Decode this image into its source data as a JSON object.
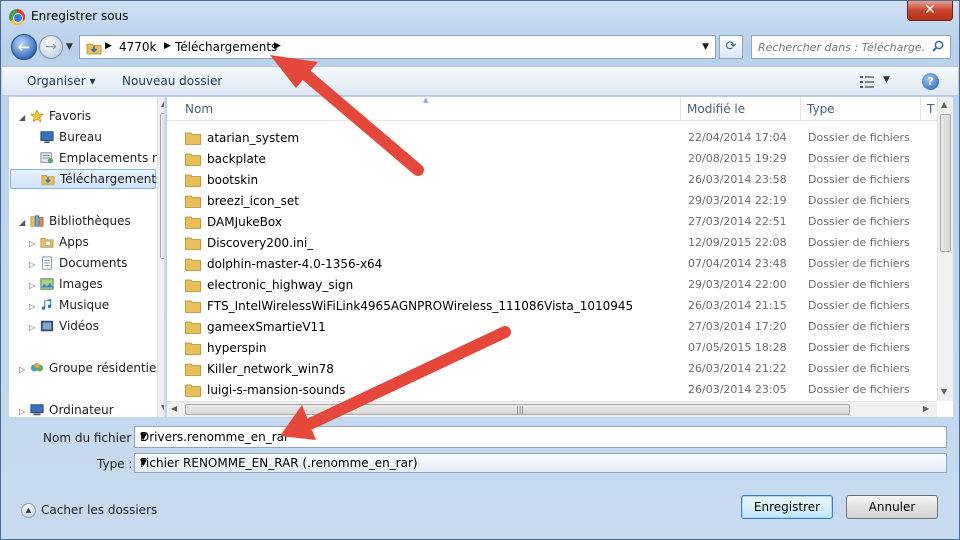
{
  "window": {
    "title": "Enregistrer sous",
    "close_label": "✕"
  },
  "address": {
    "crumbs": [
      "4770k",
      "Téléchargements"
    ],
    "search_placeholder": "Rechercher dans : Télécharge..."
  },
  "toolbar": {
    "organize_label": "Organiser ▾",
    "new_folder_label": "Nouveau dossier"
  },
  "nav": {
    "items": [
      {
        "label": "Favoris",
        "icon": "star-icon"
      },
      {
        "label": "Bureau",
        "icon": "desktop-icon"
      },
      {
        "label": "Emplacements récents",
        "icon": "recent-places-icon"
      },
      {
        "label": "Téléchargements",
        "icon": "downloads-folder-icon"
      },
      {
        "label": "Bibliothèques",
        "icon": "libraries-icon"
      },
      {
        "label": "Apps",
        "icon": "apps-icon"
      },
      {
        "label": "Documents",
        "icon": "documents-icon"
      },
      {
        "label": "Images",
        "icon": "images-icon"
      },
      {
        "label": "Musique",
        "icon": "music-icon"
      },
      {
        "label": "Vidéos",
        "icon": "videos-icon"
      },
      {
        "label": "Groupe résidentiel",
        "icon": "homegroup-icon"
      },
      {
        "label": "Ordinateur",
        "icon": "computer-icon"
      }
    ]
  },
  "columns": {
    "name": "Nom",
    "modified": "Modifié le",
    "type": "Type",
    "size": "T"
  },
  "files": [
    {
      "name": "atarian_system",
      "date": "22/04/2014 17:04",
      "type": "Dossier de fichiers"
    },
    {
      "name": "backplate",
      "date": "20/08/2015 19:29",
      "type": "Dossier de fichiers"
    },
    {
      "name": "bootskin",
      "date": "26/03/2014 23:58",
      "type": "Dossier de fichiers"
    },
    {
      "name": "breezi_icon_set",
      "date": "29/03/2014 22:19",
      "type": "Dossier de fichiers"
    },
    {
      "name": "DAMJukeBox",
      "date": "27/03/2014 22:51",
      "type": "Dossier de fichiers"
    },
    {
      "name": "Discovery200.ini_",
      "date": "12/09/2015 22:08",
      "type": "Dossier de fichiers"
    },
    {
      "name": "dolphin-master-4.0-1356-x64",
      "date": "07/04/2014 23:48",
      "type": "Dossier de fichiers"
    },
    {
      "name": "electronic_highway_sign",
      "date": "29/03/2014 22:00",
      "type": "Dossier de fichiers"
    },
    {
      "name": "FTS_IntelWirelessWiFiLink4965AGNPROWireless_111086Vista_1010945",
      "date": "26/03/2014 21:15",
      "type": "Dossier de fichiers"
    },
    {
      "name": "gameexSmartieV11",
      "date": "27/03/2014 17:20",
      "type": "Dossier de fichiers"
    },
    {
      "name": "hyperspin",
      "date": "07/05/2015 18:28",
      "type": "Dossier de fichiers"
    },
    {
      "name": "Killer_network_win78",
      "date": "26/03/2014 21:22",
      "type": "Dossier de fichiers"
    },
    {
      "name": "luigi-s-mansion-sounds",
      "date": "26/03/2014 23:05",
      "type": "Dossier de fichiers"
    }
  ],
  "form": {
    "filename_label": "Nom du fichier :",
    "filename_value": "Drivers.renomme_en_rar",
    "type_label": "Type :",
    "type_value": "Fichier RENOMME_EN_RAR (.renomme_en_rar)"
  },
  "footer": {
    "hide_folders_label": "Cacher les dossiers",
    "save_label": "Enregistrer",
    "cancel_label": "Annuler"
  },
  "colors": {
    "annotation_arrow": "#e5473a",
    "folder": "#e8c05a",
    "selection": "#cfe3fa"
  }
}
